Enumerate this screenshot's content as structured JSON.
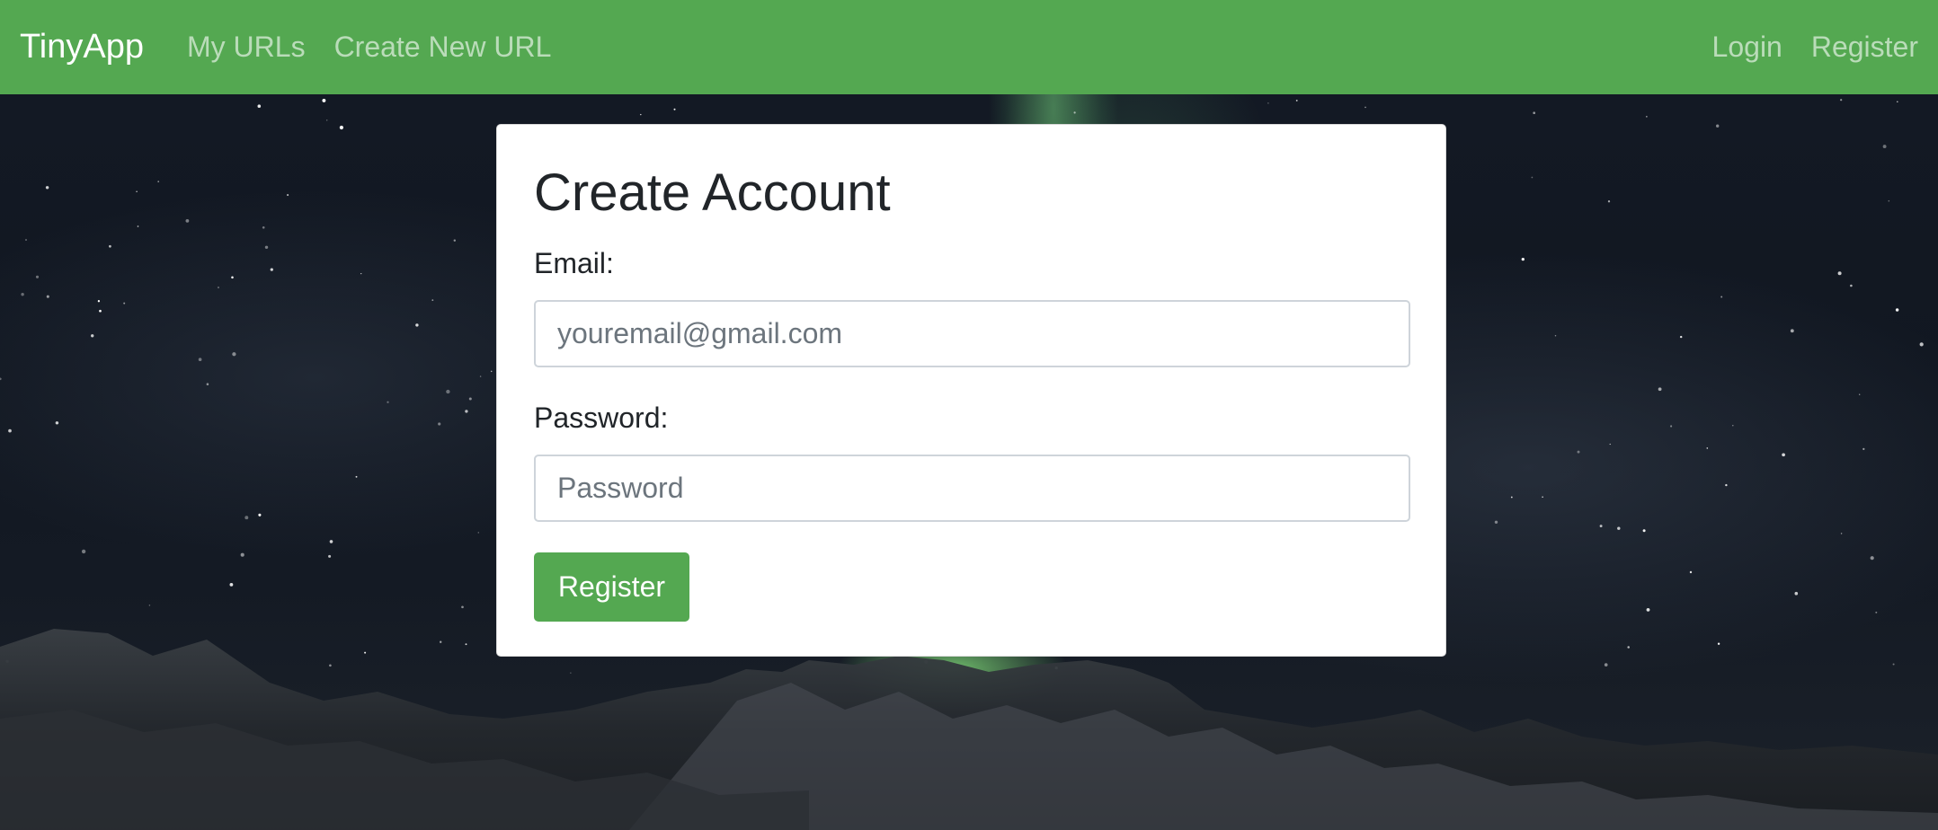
{
  "navbar": {
    "brand": "TinyApp",
    "links_left": [
      "My URLs",
      "Create New URL"
    ],
    "links_right": [
      "Login",
      "Register"
    ]
  },
  "form": {
    "title": "Create Account",
    "email_label": "Email:",
    "email_placeholder": "youremail@gmail.com",
    "email_value": "",
    "password_label": "Password:",
    "password_placeholder": "Password",
    "password_value": "",
    "submit_label": "Register"
  },
  "colors": {
    "brand_green": "#54a851",
    "text_dark": "#212529"
  }
}
